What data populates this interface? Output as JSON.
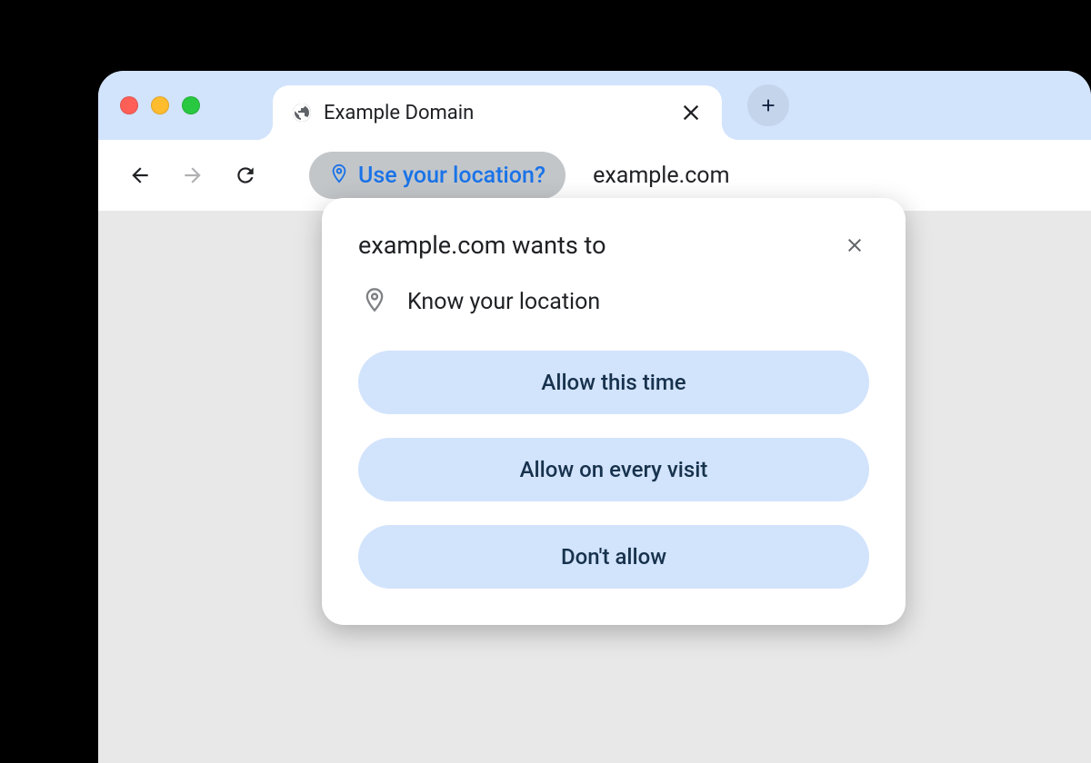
{
  "tab": {
    "title": "Example Domain"
  },
  "toolbar": {
    "location_chip": "Use your location?",
    "url": "example.com"
  },
  "popup": {
    "title": "example.com wants to",
    "permission": "Know your location",
    "buttons": {
      "allow_once": "Allow this time",
      "allow_always": "Allow on every visit",
      "deny": "Don't allow"
    }
  }
}
